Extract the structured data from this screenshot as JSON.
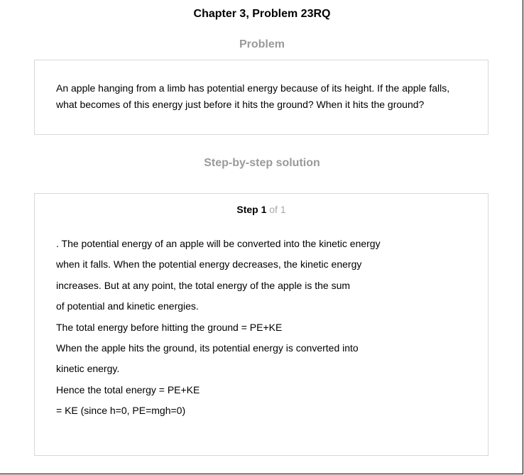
{
  "header": {
    "chapter_title": "Chapter 3, Problem 23RQ"
  },
  "problem": {
    "heading": "Problem",
    "text": "An apple hanging from a limb has potential energy because of its height. If the apple falls, what becomes of this energy just before it hits the ground? When it hits the ground?"
  },
  "solution": {
    "heading": "Step-by-step solution",
    "step": {
      "label": "Step 1",
      "of_text": " of 1"
    },
    "lines": [
      ". The potential energy of an apple will be converted into the kinetic energy",
      "when it falls. When the potential energy decreases, the kinetic energy",
      "increases. But at any point, the total energy of the apple is the sum",
      "of potential and kinetic energies.",
      "The total energy before hitting the ground = PE+KE",
      "When the apple hits the ground, its potential energy is converted into",
      "kinetic energy.",
      "Hence the total energy = PE+KE",
      "= KE (since h=0, PE=mgh=0)"
    ]
  }
}
